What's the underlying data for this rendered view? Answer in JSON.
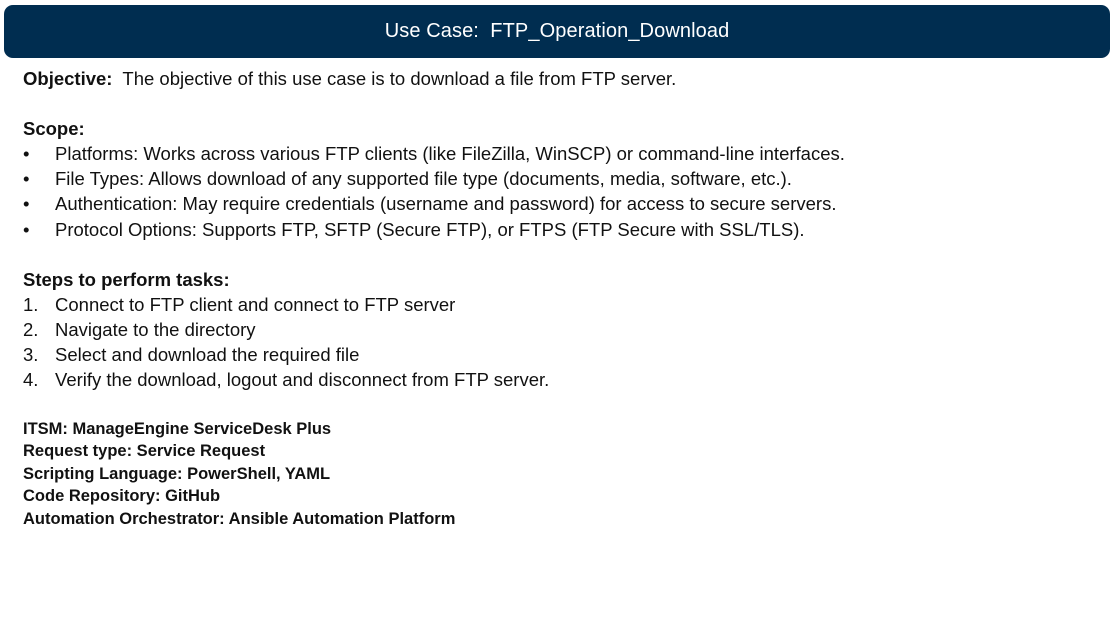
{
  "title": {
    "prefix": "Use Case:",
    "name": "FTP_Operation_Download"
  },
  "objective": {
    "label": "Objective:",
    "text": "The objective of this use case is to download a file from FTP server."
  },
  "scope": {
    "heading": "Scope:",
    "bullet_glyph": "•",
    "items": [
      "Platforms: Works across various FTP clients (like FileZilla, WinSCP) or command-line interfaces.",
      "File Types: Allows download of any supported file type (documents, media, software, etc.).",
      "Authentication: May require credentials (username and password) for access to secure servers.",
      "Protocol Options: Supports FTP, SFTP (Secure FTP), or FTPS (FTP Secure with SSL/TLS)."
    ]
  },
  "steps": {
    "heading": "Steps to perform tasks:",
    "items": [
      {
        "num": "1.",
        "text": "Connect to FTP client and connect to FTP server"
      },
      {
        "num": "2.",
        "text": "Navigate to the directory"
      },
      {
        "num": "3.",
        "text": "Select and download the required file"
      },
      {
        "num": "4.",
        "text": "Verify the download, logout and disconnect from FTP server."
      }
    ]
  },
  "meta": {
    "itsm": "ITSM: ManageEngine ServiceDesk Plus",
    "request_type": "Request type: Service Request",
    "scripting_language": "Scripting Language: PowerShell, YAML",
    "code_repository": "Code Repository: GitHub",
    "orchestrator": "Automation Orchestrator: Ansible Automation Platform"
  },
  "colors": {
    "title_bar": "#002d50",
    "title_text": "#ffffff",
    "body_text": "#111111"
  }
}
